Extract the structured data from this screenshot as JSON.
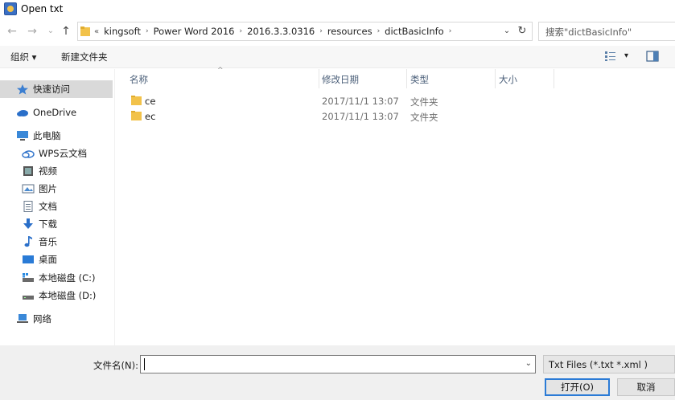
{
  "window": {
    "title": "Open txt"
  },
  "nav": {
    "back_icon": "←",
    "forward_icon": "→",
    "recent_icon": "⌄",
    "up_icon": "↑"
  },
  "address": {
    "overflow": "«",
    "crumbs": [
      "kingsoft",
      "Power Word 2016",
      "2016.3.3.0316",
      "resources",
      "dictBasicInfo"
    ],
    "sep": "›",
    "dropdown_icon": "⌄",
    "refresh_icon": "↻"
  },
  "search": {
    "placeholder": "搜索\"dictBasicInfo\""
  },
  "toolbar": {
    "organize": "组织 ▾",
    "new_folder": "新建文件夹",
    "view_dd": "▾"
  },
  "sidebar": {
    "items": [
      {
        "label": "快速访问",
        "icon": "star-icon"
      },
      {
        "label": "OneDrive",
        "icon": "cloud-icon"
      },
      {
        "label": "此电脑",
        "icon": "computer-icon"
      },
      {
        "label": "WPS云文档",
        "icon": "wps-cloud-icon"
      },
      {
        "label": "视频",
        "icon": "video-icon"
      },
      {
        "label": "图片",
        "icon": "picture-icon"
      },
      {
        "label": "文档",
        "icon": "document-icon"
      },
      {
        "label": "下载",
        "icon": "download-icon"
      },
      {
        "label": "音乐",
        "icon": "music-icon"
      },
      {
        "label": "桌面",
        "icon": "desktop-icon"
      },
      {
        "label": "本地磁盘 (C:)",
        "icon": "drive-icon"
      },
      {
        "label": "本地磁盘 (D:)",
        "icon": "drive-icon"
      },
      {
        "label": "网络",
        "icon": "network-icon"
      }
    ]
  },
  "files": {
    "columns": [
      "名称",
      "修改日期",
      "类型",
      "大小"
    ],
    "sort_arrow": "^",
    "rows": [
      {
        "name": "ce",
        "date": "2017/11/1 13:07",
        "type": "文件夹"
      },
      {
        "name": "ec",
        "date": "2017/11/1 13:07",
        "type": "文件夹"
      }
    ]
  },
  "bottom": {
    "filename_label": "文件名(N):",
    "filename_value": "",
    "filename_dd": "⌄",
    "filetype": "Txt Files (*.txt *.xml )",
    "open_button": "打开(O)",
    "cancel_button": "取消"
  },
  "colors": {
    "accent": "#2b7bd6",
    "folder": "#f2c24a",
    "selected_bg": "#d9d9d9"
  }
}
